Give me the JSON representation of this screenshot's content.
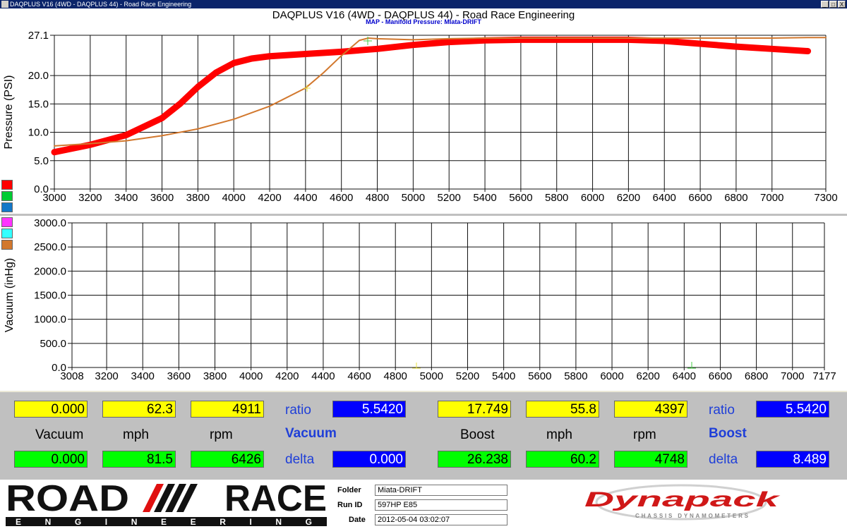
{
  "window": {
    "titlebar_text": "DAQPLUS V16 (4WD - DAQPLUS 44) - Road Race Engineering",
    "buttons": [
      "_",
      "□",
      "X"
    ]
  },
  "header": {
    "title": "DAQPLUS V16 (4WD - DAQPLUS 44) - Road Race Engineering",
    "subtitle": "MAP - Manifold Pressure: Miata-DRIFT"
  },
  "colors": {
    "red": "#ff0000",
    "orange": "#d2782e",
    "swatches_top": [
      "#ff0000",
      "#00cc33",
      "#1478c8"
    ],
    "swatches_bottom": [
      "#ff33ff",
      "#33ffff",
      "#d2782e"
    ]
  },
  "chart_data": [
    {
      "type": "line",
      "ylabel": "Pressure (PSI)",
      "xlabel": "",
      "x_ticks": [
        "3000",
        "3200",
        "3400",
        "3600",
        "3800",
        "4000",
        "4200",
        "4400",
        "4600",
        "4800",
        "5000",
        "5200",
        "5400",
        "5600",
        "5800",
        "6000",
        "6200",
        "6400",
        "6600",
        "6800",
        "7000",
        "7300"
      ],
      "y_ticks": [
        "0.0",
        "5.0",
        "10.0",
        "15.0",
        "20.0",
        "27.1"
      ],
      "xlim": [
        3000,
        7300
      ],
      "ylim": [
        0,
        27.1
      ],
      "grid": true,
      "series": [
        {
          "color": "#ff0000",
          "x": [
            3000,
            3200,
            3400,
            3600,
            3700,
            3800,
            3900,
            4000,
            4100,
            4200,
            4400,
            4600,
            4800,
            5000,
            5200,
            5400,
            5600,
            5800,
            6000,
            6200,
            6400,
            6600,
            6800,
            7000,
            7200
          ],
          "y": [
            6.5,
            7.8,
            9.5,
            12.5,
            15,
            18,
            20.5,
            22.2,
            23,
            23.4,
            23.8,
            24.2,
            24.7,
            25.4,
            25.9,
            26.2,
            26.3,
            26.3,
            26.3,
            26.3,
            26.1,
            25.6,
            25.1,
            24.7,
            24.3
          ]
        },
        {
          "color": "#d2782e",
          "x": [
            3000,
            3200,
            3400,
            3600,
            3800,
            4000,
            4200,
            4400,
            4500,
            4600,
            4700,
            4750,
            4800,
            5000,
            5200,
            5400,
            5600,
            5800,
            6000,
            6200,
            6400,
            6600,
            6800,
            7000,
            7200,
            7300
          ],
          "y": [
            7.6,
            8.0,
            8.5,
            9.4,
            10.6,
            12.3,
            14.6,
            17.8,
            20.5,
            23.5,
            26.2,
            26.6,
            26.5,
            26.3,
            26.5,
            26.6,
            26.6,
            26.6,
            26.6,
            26.6,
            26.6,
            26.6,
            26.6,
            26.6,
            26.7,
            26.7
          ]
        }
      ]
    },
    {
      "type": "line",
      "ylabel": "Vacuum (inHg)",
      "xlabel": "",
      "x_ticks": [
        "3008",
        "3200",
        "3400",
        "3600",
        "3800",
        "4000",
        "4200",
        "4400",
        "4600",
        "4800",
        "5000",
        "5200",
        "5400",
        "5600",
        "5800",
        "6000",
        "6200",
        "6400",
        "6600",
        "6800",
        "7000",
        "7177"
      ],
      "y_ticks": [
        "0.0",
        "500.0",
        "1000.0",
        "1500.0",
        "2000.0",
        "2500.0",
        "3000.0"
      ],
      "xlim": [
        3008,
        7177
      ],
      "ylim": [
        0,
        3000
      ],
      "grid": true,
      "series": []
    }
  ],
  "readouts": {
    "vacuum": {
      "row1": [
        "0.000",
        "62.3",
        "4911"
      ],
      "labels": [
        "Vacuum",
        "mph",
        "rpm"
      ],
      "row2": [
        "0.000",
        "81.5",
        "6426"
      ],
      "ratio_label": "ratio",
      "ratio": "5.5420",
      "title": "Vacuum",
      "delta_label": "delta",
      "delta": "0.000"
    },
    "boost": {
      "row1": [
        "17.749",
        "55.8",
        "4397"
      ],
      "labels": [
        "Boost",
        "mph",
        "rpm"
      ],
      "row2": [
        "26.238",
        "60.2",
        "4748"
      ],
      "ratio_label": "ratio",
      "ratio": "5.5420",
      "title": "Boost",
      "delta_label": "delta",
      "delta": "8.489"
    }
  },
  "footer": {
    "logo_text": "ROAD RACE",
    "logo_sub": "ENGINEERING",
    "folder_label": "Folder",
    "folder_value": "Miata-DRIFT",
    "runid_label": "Run ID",
    "runid_value": "597HP E85",
    "date_label": "Date",
    "date_value": "2012-05-04 03:02:07",
    "dyno_logo": "Dynapack",
    "dyno_sub": "CHASSIS DYNAMOMETERS"
  }
}
